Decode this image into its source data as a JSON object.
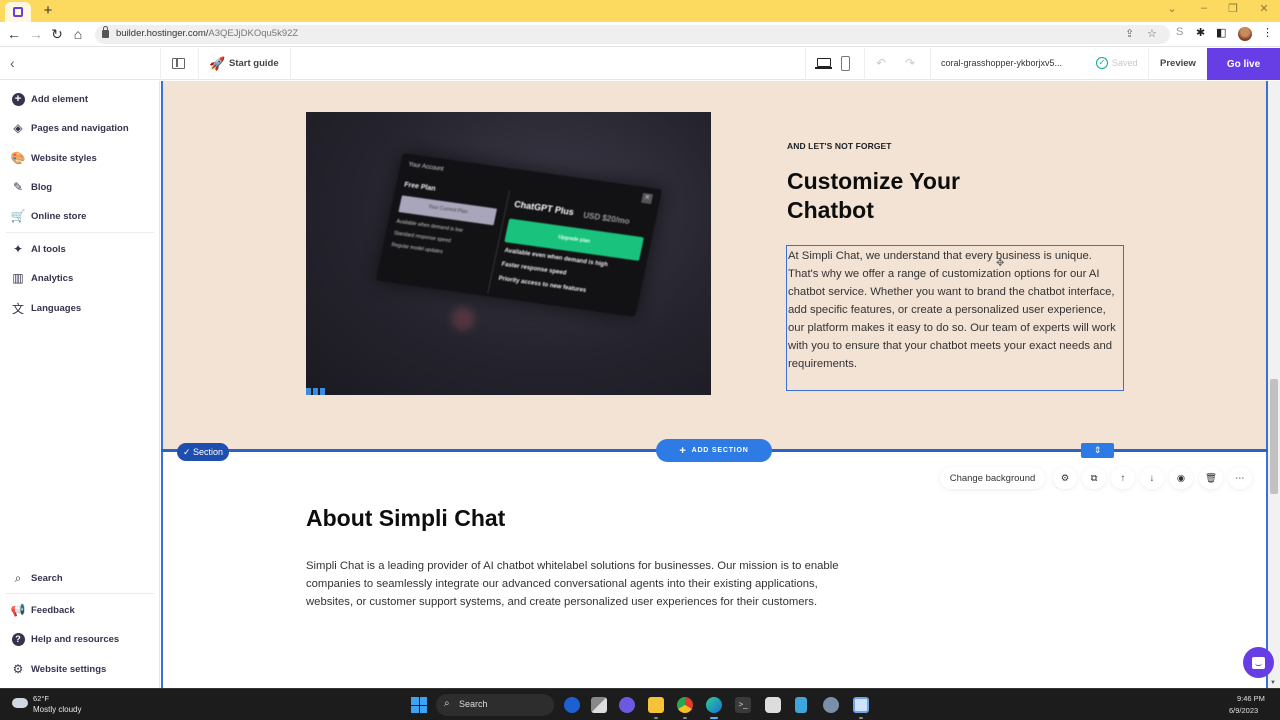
{
  "browser": {
    "new_tab_label": "+",
    "window_controls": [
      "⌄",
      "–",
      "❐",
      "✕"
    ],
    "url_domain": "builder.hostinger.com/",
    "url_path": "A3QEJjDKOqu5k92Z",
    "extension_s": "S"
  },
  "topbar": {
    "back_icon": "‹",
    "start_guide": "Start guide",
    "site_name": "coral-grasshopper-ykborjxv5...",
    "saved_label": "Saved",
    "preview_label": "Preview",
    "go_live_label": "Go live"
  },
  "sidebar": {
    "items": [
      {
        "label": "Add element",
        "icon": "plus-circle-icon"
      },
      {
        "label": "Pages and navigation",
        "icon": "layers-icon"
      },
      {
        "label": "Website styles",
        "icon": "palette-icon"
      },
      {
        "label": "Blog",
        "icon": "pen-icon"
      },
      {
        "label": "Online store",
        "icon": "cart-icon"
      },
      {
        "label": "AI tools",
        "icon": "sparkle-icon"
      },
      {
        "label": "Analytics",
        "icon": "chart-icon"
      },
      {
        "label": "Languages",
        "icon": "translate-icon"
      }
    ],
    "bottom_items": [
      {
        "label": "Search",
        "icon": "search-icon"
      },
      {
        "label": "Feedback",
        "icon": "megaphone-icon"
      },
      {
        "label": "Help and resources",
        "icon": "help-icon"
      },
      {
        "label": "Website settings",
        "icon": "gear-icon"
      }
    ]
  },
  "canvas": {
    "image_card": {
      "your_account": "Your Account",
      "free_plan": "Free Plan",
      "current_plan": "Your Current Plan",
      "free_features": [
        "Available when demand is low",
        "Standard response speed",
        "Regular model updates"
      ],
      "plus_title": "ChatGPT Plus",
      "plus_price": "USD $20/mo",
      "upgrade": "Upgrade plan",
      "plus_features": [
        "Available even when demand is high",
        "Faster response speed",
        "Priority access to new features"
      ]
    },
    "eyebrow": "AND LET'S NOT FORGET",
    "heading": "Customize Your Chatbot",
    "body": "At Simpli Chat, we understand that every business is unique. That's why we offer a range of customization options for our AI chatbot service. Whether you want to brand the chatbot interface, add specific features, or create a personalized user experience, our platform makes it easy to do so. Our team of experts will work with you to ensure that your chatbot meets your exact needs and requirements.",
    "section_badge": "✓ Section",
    "add_section": "ADD SECTION",
    "change_background": "Change background",
    "about_title": "About Simpli Chat",
    "about_text": "Simpli Chat is a leading provider of AI chatbot whitelabel solutions for businesses. Our mission is to enable companies to seamlessly integrate our advanced conversational agents into their existing applications, websites, or customer support systems, and create personalized user experiences for their customers."
  },
  "taskbar": {
    "temperature": "62°F",
    "condition": "Mostly cloudy",
    "search_label": "Search",
    "time": "9:46 PM",
    "date": "6/9/2023"
  },
  "colors": {
    "brand": "#673de6",
    "selection": "#3a70d8",
    "section_bg": "#f2e3d5"
  }
}
